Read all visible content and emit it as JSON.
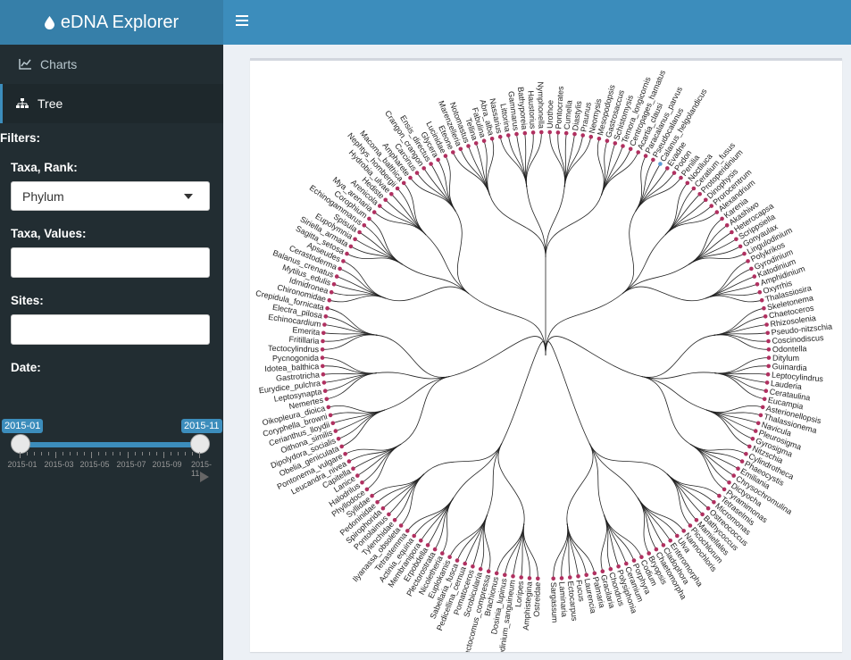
{
  "app": {
    "title": "eDNA Explorer"
  },
  "sidebar": {
    "items": [
      {
        "label": "Charts",
        "icon": "line-chart-icon",
        "active": false
      },
      {
        "label": "Tree",
        "icon": "sitemap-icon",
        "active": true
      }
    ],
    "filters_title": "Filters:",
    "taxa_rank": {
      "label": "Taxa, Rank:",
      "value": "Phylum"
    },
    "taxa_values": {
      "label": "Taxa, Values:",
      "value": ""
    },
    "sites": {
      "label": "Sites:",
      "value": ""
    },
    "date": {
      "label": "Date:",
      "from": "2015-01",
      "to": "2015-11",
      "ticks": [
        "2015-01",
        "2015-03",
        "2015-05",
        "2015-07",
        "2015-09",
        "2015-11"
      ]
    }
  },
  "tree": {
    "leaf_color": "#b03060",
    "highlight_color": "#5b9bd5",
    "leaves": [
      "Ostreidae",
      "Amphistegina",
      "Loripes",
      "Gymnodinium_sanguineum",
      "Dosinia_lupinus",
      "Brachionus",
      "Plectocomus_compressa",
      "Scrobicularia",
      "Pomatoceros",
      "Pedicellina_cernua",
      "Sabellaria_fusca",
      "Euplokamis",
      "Nicoletheria",
      "Plectorostrata",
      "Erpobdella",
      "Membranipora",
      "Actinia_equina",
      "Tetrastemma",
      "Ilyanassa_obsoleta",
      "Tylenchidae",
      "Pontolaimus",
      "Spirophorida",
      "Pedoninidae",
      "Syllidae",
      "Phyllodoce",
      "Halodrilus",
      "Lanice",
      "Capitella",
      "Leucandra_nivea",
      "Pontonema_vulgare",
      "Obelia_geniculata",
      "Dipolydora_socialis",
      "Oithona_similis",
      "Cerianthus_lloydii",
      "Coryphella_browni",
      "Oikopleura_dioica",
      "Nemertes",
      "Leptosynapta",
      "Eurydice_pulchra",
      "Gastrotricha",
      "Idotea_balthica",
      "Pycnogonida",
      "Tectocylindrus",
      "Fritillaria",
      "Emerita",
      "Echinocardium",
      "Electra_pilosa",
      "Crepidula_fornicata",
      "Chironomidae",
      "Idmidronea",
      "Mytilus_edulis",
      "Balanus_crenatus",
      "Cerastoderma",
      "Apseudes",
      "Sagitta_setosa",
      "Siriella_armata",
      "Eupolymnia",
      "Spisula",
      "Echinogammarus",
      "Corophium",
      "Mya_arenaria",
      "Arenicola",
      "Hediste",
      "Hydrobia_ulvae",
      "Nephtys_hombergii",
      "Macoma_balthica",
      "Ampharete",
      "Carcinus",
      "Crangon_crangon",
      "Ensis_directus",
      "Glycera",
      "Lucinidae",
      "Eteone",
      "Marenzelleria",
      "Notomastus",
      "Tellina",
      "Fabulina",
      "Abra_alba",
      "Nassarius",
      "Littorina",
      "Gammarus",
      "Bathyporeia",
      "Haustorius",
      "Nymphonella",
      "Urothoe",
      "Pontocrates",
      "Cumella",
      "Diastylis",
      "Praunus",
      "Neomysis",
      "Mesopodopsis",
      "Gastrosaccus",
      "Schistomysis",
      "Temora_longicornis",
      "Centropages_hamatus",
      "Acartia_clausi",
      "Paracalanus_parvus",
      "Pseudocalanus",
      "Calanus_helgolandicus",
      "Evadne",
      "Podon",
      "Penilia",
      "Noctiluca",
      "Ceratium_fusus",
      "Protoperidinium",
      "Dinophysis",
      "Prorocentrum",
      "Alexandrium",
      "Karenia",
      "Akashiwo",
      "Heterocapsa",
      "Scrippsiella",
      "Gonyaulax",
      "Lingulodinium",
      "Polykrikos",
      "Gyrodinium",
      "Katodinium",
      "Amphidinium",
      "Oxyrrhis",
      "Thalassiosira",
      "Skeletonema",
      "Chaetoceros",
      "Rhizosolenia",
      "Pseudo-nitzschia",
      "Coscinodiscus",
      "Odontella",
      "Ditylum",
      "Guinardia",
      "Leptocylindrus",
      "Lauderia",
      "Cerataulina",
      "Eucampia",
      "Asterionellopsis",
      "Thalassionema",
      "Navicula",
      "Pleurosigma",
      "Gyrosigma",
      "Nitzschia",
      "Cylindrotheca",
      "Phaeocystis",
      "Emiliania",
      "Chrysochromulina",
      "Dictyocha",
      "Pyramimonas",
      "Tetraselmis",
      "Micromonas",
      "Ostreococcus",
      "Bathycoccus",
      "Mamiellales",
      "Picochlorum",
      "Nannochloris",
      "Ulva",
      "Enteromorpha",
      "Cladophora",
      "Chaetomorpha",
      "Bryopsis",
      "Codium",
      "Porphyra",
      "Ceramium",
      "Polysiphonia",
      "Chondrus",
      "Gracilaria",
      "Palmaria",
      "Laurencia",
      "Fucus",
      "Ectocarpus",
      "Laminaria",
      "Sargassum"
    ],
    "highlight_indices": [
      98
    ]
  }
}
